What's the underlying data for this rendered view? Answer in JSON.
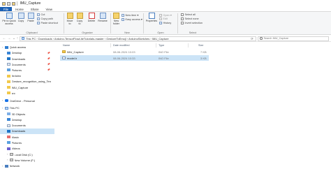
{
  "window": {
    "title": "IMU_Capture"
  },
  "tabs": [
    "File",
    "Home",
    "Share",
    "View"
  ],
  "ribbon": {
    "clipboard": {
      "label": "Clipboard",
      "pin": "Pin to Quick access",
      "copy": "Copy",
      "paste": "Paste",
      "cut": "Cut",
      "copy_path": "Copy path",
      "paste_shortcut": "Paste shortcut"
    },
    "organize": {
      "label": "Organize",
      "move_to": "Move to",
      "copy_to": "Copy to",
      "delete": "Delete",
      "rename": "Rename"
    },
    "new": {
      "label": "New",
      "new_folder": "New folder",
      "new_item": "New item ▾",
      "easy_access": "Easy access ▾"
    },
    "open": {
      "label": "Open",
      "properties": "Properties",
      "open": "Open ▾",
      "edit": "Edit",
      "history": "History"
    },
    "select": {
      "label": "Select",
      "select_all": "Select all",
      "select_none": "Select none",
      "invert_selection": "Invert selection"
    }
  },
  "address": {
    "path": "This PC  ›  Downloads  ›  Arduino-TensorFlowLiteTutorials-master  ›  GestureToEmoji  ›  ArduinoSketches  ›  IMU_Capture",
    "search_placeholder": "Search IMU_Capture"
  },
  "nav": {
    "items": [
      {
        "label": "Quick access",
        "icon": "star-icon"
      },
      {
        "label": "Desktop",
        "icon": "desktop-icon",
        "pinned": true
      },
      {
        "label": "Downloads",
        "icon": "download-icon",
        "pinned": true
      },
      {
        "label": "Documents",
        "icon": "document-icon",
        "pinned": true
      },
      {
        "label": "Pictures",
        "icon": "pictures-icon",
        "pinned": true
      },
      {
        "label": "Arduino",
        "icon": "folder-icon"
      },
      {
        "label": "Gesture_recognition_using_Ten",
        "icon": "folder-icon"
      },
      {
        "label": "IMU_Capture",
        "icon": "folder-icon"
      },
      {
        "label": "src",
        "icon": "folder-icon"
      },
      {
        "label": "OneDrive - Personal",
        "icon": "cloud-icon"
      },
      {
        "label": "This PC",
        "icon": "pc-icon"
      },
      {
        "label": "3D Objects",
        "icon": "3d-objects-icon"
      },
      {
        "label": "Desktop",
        "icon": "desktop-icon"
      },
      {
        "label": "Documents",
        "icon": "document-icon"
      },
      {
        "label": "Downloads",
        "icon": "download-icon"
      },
      {
        "label": "Music",
        "icon": "music-icon"
      },
      {
        "label": "Pictures",
        "icon": "pictures-icon"
      },
      {
        "label": "Videos",
        "icon": "video-icon"
      },
      {
        "label": "Local Disk (C:)",
        "icon": "drive-icon"
      },
      {
        "label": "New Volume (F:)",
        "icon": "drive-icon"
      },
      {
        "label": "Network",
        "icon": "network-icon"
      }
    ],
    "pin_glyph": "📌",
    "chevron": "›"
  },
  "columns": {
    "name": "Name",
    "date": "Date modified",
    "type": "Type",
    "size": "Size"
  },
  "files": [
    {
      "name": "IMU_Capture",
      "date": "08-06-2024 10:03",
      "type": "INO File",
      "size": "7 KB"
    },
    {
      "name": "model.h",
      "date": "08-06-2024 10:33",
      "type": "INO File",
      "size": "3 KB"
    }
  ]
}
